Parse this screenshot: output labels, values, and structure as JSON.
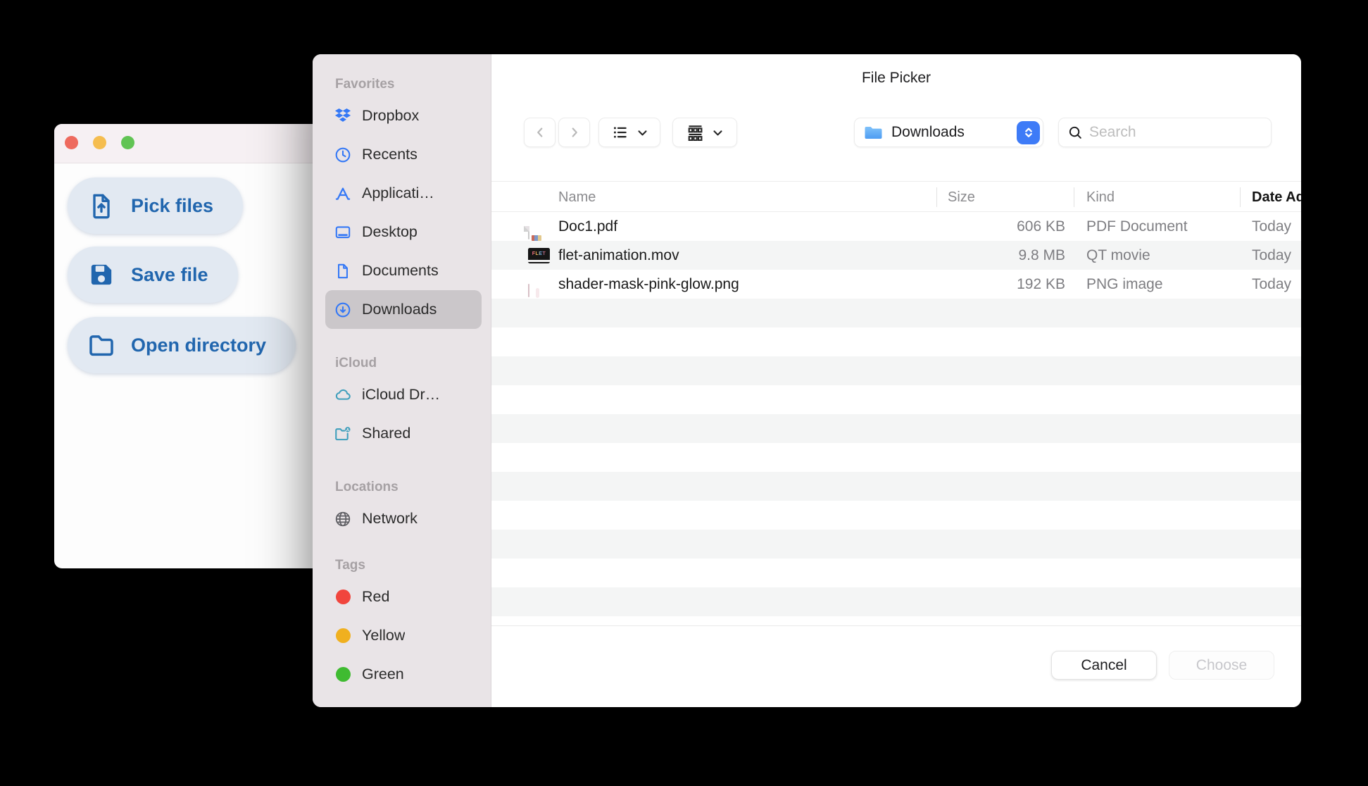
{
  "app_window": {
    "buttons": [
      {
        "label": "Pick files",
        "icon": "file-upload-icon"
      },
      {
        "label": "Save file",
        "icon": "save-icon"
      },
      {
        "label": "Open directory",
        "icon": "folder-icon"
      }
    ]
  },
  "dialog": {
    "title": "File Picker",
    "sidebar": {
      "sections": [
        {
          "label": "Favorites",
          "items": [
            {
              "label": "Dropbox",
              "icon": "dropbox-icon"
            },
            {
              "label": "Recents",
              "icon": "clock-icon"
            },
            {
              "label": "Applications",
              "icon": "appstore-icon"
            },
            {
              "label": "Desktop",
              "icon": "desktop-icon"
            },
            {
              "label": "Documents",
              "icon": "document-icon"
            },
            {
              "label": "Downloads",
              "icon": "download-circle-icon",
              "selected": true
            }
          ]
        },
        {
          "label": "iCloud",
          "items": [
            {
              "label": "iCloud Drive",
              "icon": "cloud-icon"
            },
            {
              "label": "Shared",
              "icon": "shared-folder-icon"
            }
          ]
        },
        {
          "label": "Locations",
          "items": [
            {
              "label": "Network",
              "icon": "globe-icon"
            }
          ]
        },
        {
          "label": "Tags",
          "items": [
            {
              "label": "Red",
              "color": "#f1453d"
            },
            {
              "label": "Yellow",
              "color": "#f0b01f"
            },
            {
              "label": "Green",
              "color": "#3fbb31"
            }
          ]
        }
      ]
    },
    "toolbar": {
      "location": "Downloads",
      "search_placeholder": "Search"
    },
    "table": {
      "columns": {
        "name": "Name",
        "size": "Size",
        "kind": "Kind",
        "date": "Date Added"
      },
      "sorted_column": "Date Added",
      "rows": [
        {
          "name": "Doc1.pdf",
          "size": "606 KB",
          "kind": "PDF Document",
          "date": "Today",
          "icon": "pdf-file-icon"
        },
        {
          "name": "flet-animation.mov",
          "size": "9.8 MB",
          "kind": "QT movie",
          "date": "Today",
          "icon": "mov-file-icon",
          "thumbnail_text": "FLET"
        },
        {
          "name": "shader-mask-pink-glow.png",
          "size": "192 KB",
          "kind": "PNG image",
          "date": "Today",
          "icon": "png-file-icon"
        }
      ]
    },
    "footer": {
      "cancel_label": "Cancel",
      "choose_label": "Choose",
      "choose_disabled": true
    }
  },
  "colors": {
    "accent_blue": "#3478f6",
    "icloud_teal": "#3f9fbc",
    "app_button_blue": "#2166ae",
    "stepper_blue": "#3e7bf7",
    "traffic_red": "#ee6a5e",
    "traffic_yellow": "#f5bd4f",
    "traffic_green": "#61c454",
    "tag_red": "#f1453d",
    "tag_yellow": "#f0b01f",
    "tag_green": "#3fbb31",
    "sidebar_bg": "#e9e4e7",
    "sidebar_selected": "#cbc7ca",
    "row_stripe": "#f4f5f5"
  }
}
